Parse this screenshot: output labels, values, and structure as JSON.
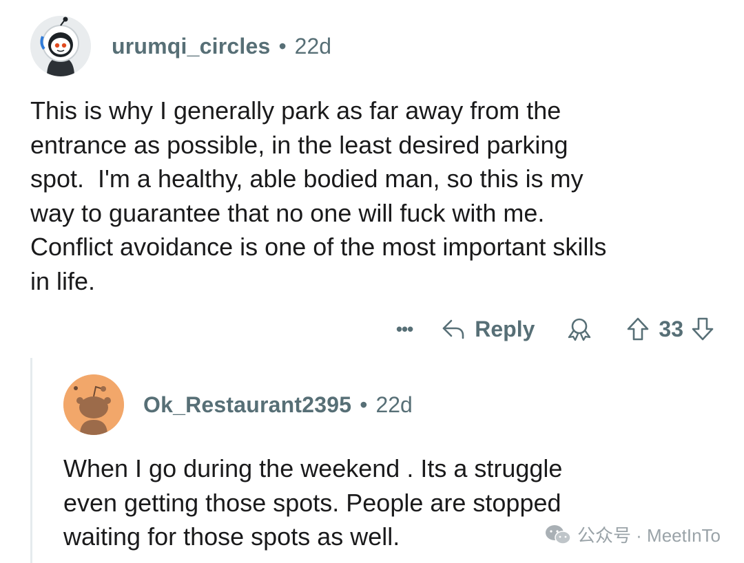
{
  "comments": [
    {
      "author": "urumqi_circles",
      "separator": "•",
      "age": "22d",
      "body": "This is why I generally park as far away from the\nentrance as possible, in the least desired parking\nspot.  I'm a healthy, able bodied man, so this is my\nway to guarantee that no one will fuck with me.\nConflict avoidance is one of the most important skills\nin life.",
      "actions": {
        "more_label": "•••",
        "reply_label": "Reply",
        "score": "33"
      }
    },
    {
      "author": "Ok_Restaurant2395",
      "separator": "•",
      "age": "22d",
      "body": "When I go during the weekend . Its a struggle\neven getting those spots. People are stopped\nwaiting for those spots as well."
    }
  ],
  "watermark": {
    "text": "公众号 · MeetInTo"
  },
  "icons": {
    "more": "more-dots-icon",
    "reply": "reply-arrow-icon",
    "award": "award-icon",
    "upvote": "upvote-arrow-icon",
    "downvote": "downvote-arrow-icon",
    "watermark": "wechat-icon"
  },
  "colors": {
    "meta_text": "#576f76",
    "body_text": "#1a1a1b",
    "avatar2_bg": "#f2a76a",
    "thread_line": "#e5ebee"
  }
}
